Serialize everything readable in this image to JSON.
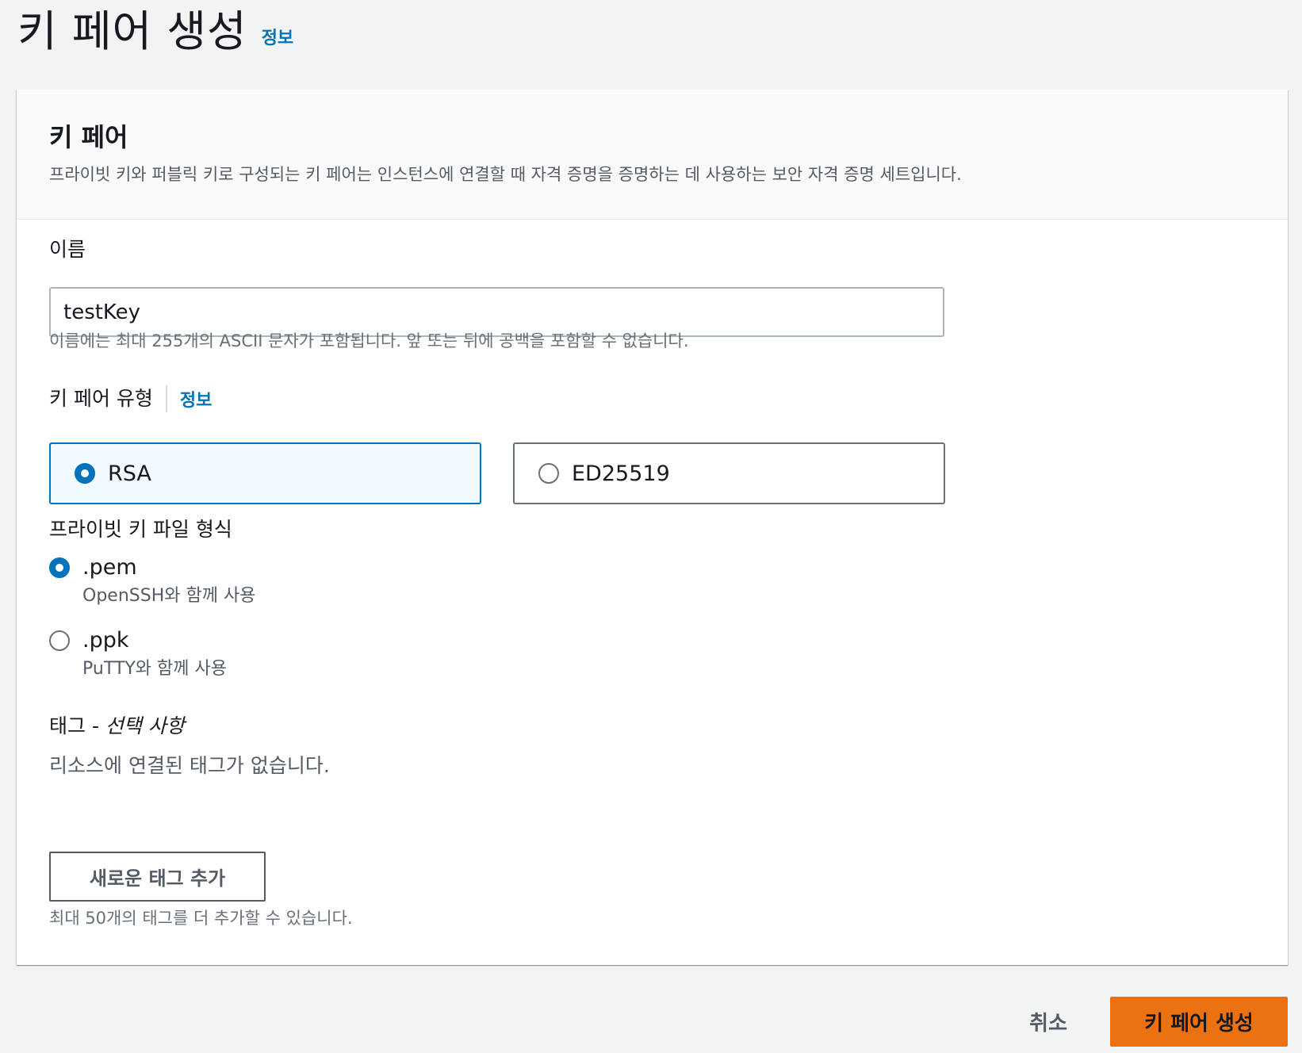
{
  "header": {
    "title": "키 페어 생성",
    "info_link": "정보"
  },
  "card": {
    "title": "키 페어",
    "description": "프라이빗 키와 퍼블릭 키로 구성되는 키 페어는 인스턴스에 연결할 때 자격 증명을 증명하는 데 사용하는 보안 자격 증명 세트입니다."
  },
  "name_field": {
    "label": "이름",
    "value": "testKey",
    "hint": "이름에는 최대 255개의 ASCII 문자가 포함됩니다. 앞 또는 뒤에 공백을 포함할 수 없습니다."
  },
  "key_type": {
    "label": "키 페어 유형",
    "info_link": "정보",
    "options": [
      {
        "label": "RSA",
        "selected": true
      },
      {
        "label": "ED25519",
        "selected": false
      }
    ]
  },
  "file_format": {
    "label": "프라이빗 키 파일 형식",
    "options": [
      {
        "label": ".pem",
        "description": "OpenSSH와 함께 사용",
        "selected": true
      },
      {
        "label": ".ppk",
        "description": "PuTTY와 함께 사용",
        "selected": false
      }
    ]
  },
  "tags": {
    "label_prefix": "태그 - ",
    "label_optional": "선택 사항",
    "empty_text": "리소스에 연결된 태그가 없습니다.",
    "add_button": "새로운 태그 추가",
    "limit_hint": "최대 50개의 태그를 더 추가할 수 있습니다."
  },
  "footer": {
    "cancel_label": "취소",
    "submit_label": "키 페어 생성"
  },
  "colors": {
    "accent": "#0073bb",
    "primary_button": "#ec7211",
    "background": "#f2f3f3"
  }
}
